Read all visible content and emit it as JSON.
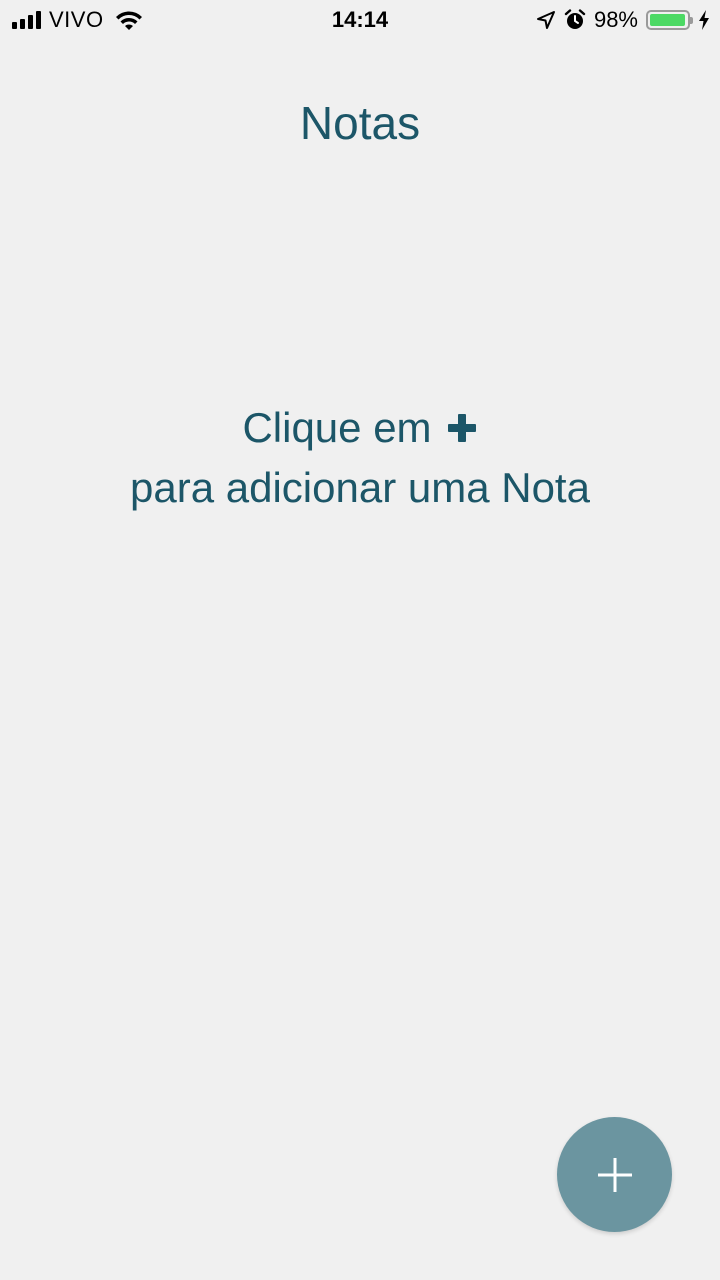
{
  "status_bar": {
    "carrier": "VIVO",
    "time": "14:14",
    "battery_percent": "98%",
    "battery_level": 0.98,
    "battery_color": "#4cd964"
  },
  "header": {
    "title": "Notas"
  },
  "empty_state": {
    "line1_text": "Clique em",
    "line1_icon": "plus-icon",
    "line2_text": "para adicionar uma Nota"
  },
  "fab": {
    "icon": "plus-icon",
    "color": "#6b95a0"
  },
  "colors": {
    "background": "#f0f0f0",
    "accent_text": "#1c5668"
  }
}
